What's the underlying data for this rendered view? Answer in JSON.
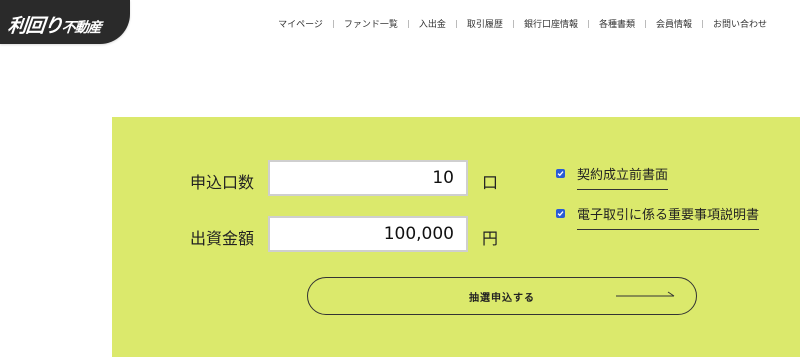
{
  "logo": {
    "main": "利回り",
    "sub": "不動産"
  },
  "nav": {
    "items": [
      "マイページ",
      "ファンド一覧",
      "入出金",
      "取引履歴",
      "銀行口座情報",
      "各種書類",
      "会員情報",
      "お問い合わせ"
    ]
  },
  "form": {
    "units_label": "申込口数",
    "units_value": "10",
    "units_suffix": "口",
    "amount_label": "出資金額",
    "amount_value": "100,000",
    "amount_suffix": "円"
  },
  "documents": [
    {
      "label": "契約成立前書面",
      "checked": true
    },
    {
      "label": "電子取引に係る重要事項説明書",
      "checked": true
    }
  ],
  "submit": {
    "label": "抽選申込する"
  },
  "colors": {
    "panel": "#dbe96c",
    "logo_bg": "#2a2a2a",
    "checkbox": "#2a5bd7"
  }
}
